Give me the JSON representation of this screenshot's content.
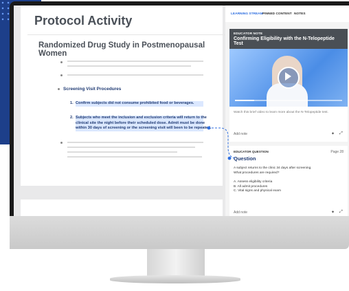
{
  "doc": {
    "title": "Protocol Activity",
    "study_title": "Randomized Drug Study in Postmenopausal Women",
    "section_label": "Screening Visit Procedures",
    "items": [
      {
        "num": "1.",
        "text": "Confirm subjects did not consume prohibited food or beverages."
      },
      {
        "num": "2.",
        "lines": [
          "Subjects who meet the inclusion and exclusion criteria will return to the",
          "clinical site the night before their scheduled dose. Admit must be done",
          "within 30 days of screening or the screening visit will been to be repeated."
        ]
      }
    ]
  },
  "panel": {
    "tabs": [
      "LEARNING STREAM",
      "PINNED CONTENT",
      "NOTES"
    ],
    "note_card": {
      "eyebrow": "EDUCATOR NOTE",
      "title": "Confirming Eligibility with the N-Telopeptide Test",
      "caption": "Watch this brief video to learn more about the N-Telopeptide test.",
      "add_note": "Add note",
      "video_progress": 0.18
    },
    "question_card": {
      "eyebrow": "EDUCATOR QUESTION",
      "page": "Page 28",
      "title": "Question",
      "prompt_lines": [
        "A subject returns to the clinic 34 days after screening.",
        "What procedures are required?"
      ],
      "options": [
        "A. Assess eligibility criteria",
        "B. All admit procedures",
        "C. Vital signs and physical exam"
      ],
      "add_note": "Add note"
    },
    "icons": {
      "pin": "pin-icon",
      "expand": "expand-icon"
    }
  },
  "colors": {
    "accent": "#1f3a73",
    "link": "#2f6fe0",
    "header": "#4a4f55"
  }
}
